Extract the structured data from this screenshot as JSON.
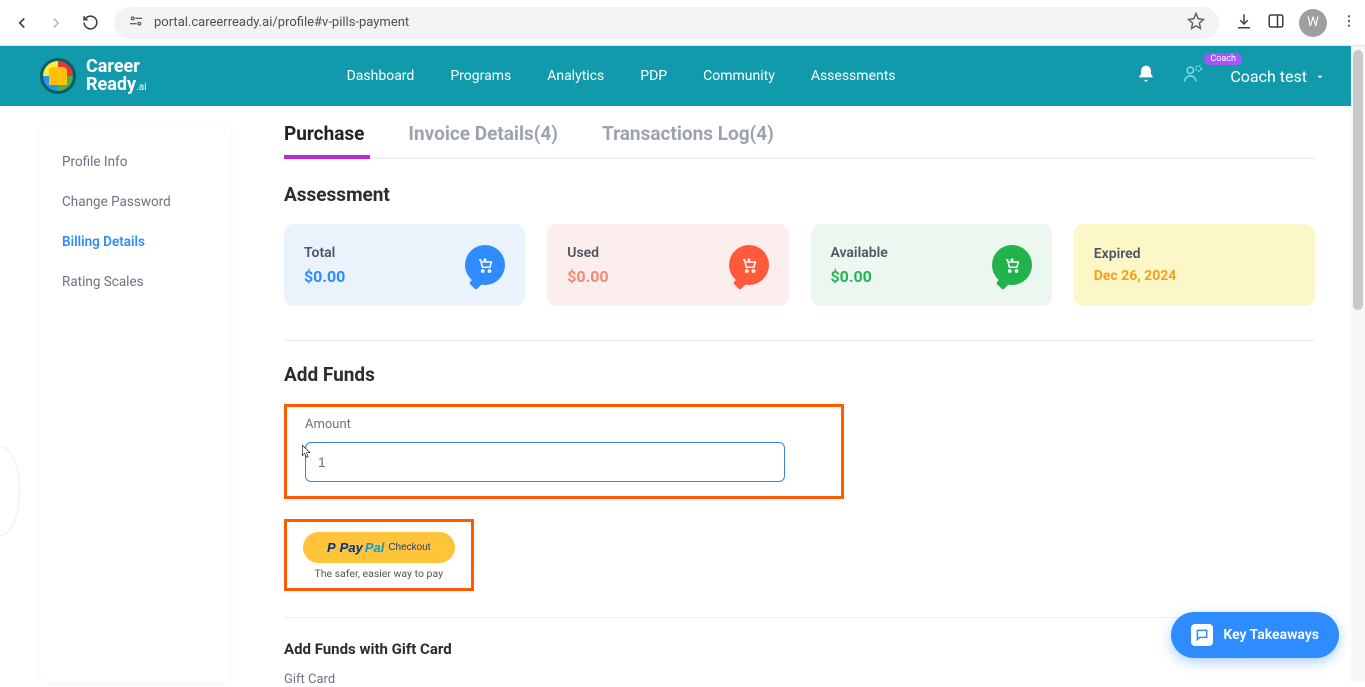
{
  "browser": {
    "url": "portal.careerready.ai/profile#v-pills-payment",
    "profile_initial": "W"
  },
  "appbar": {
    "logo_line1": "Career",
    "logo_line2": "Ready",
    "logo_suffix": ".ai",
    "nav": [
      "Dashboard",
      "Programs",
      "Analytics",
      "PDP",
      "Community",
      "Assessments"
    ],
    "badge": "Coach",
    "user": "Coach test"
  },
  "sidebar": {
    "items": [
      {
        "label": "Profile Info",
        "active": false
      },
      {
        "label": "Change Password",
        "active": false
      },
      {
        "label": "Billing Details",
        "active": true
      },
      {
        "label": "Rating Scales",
        "active": false
      }
    ]
  },
  "tabs": [
    {
      "label": "Purchase",
      "active": true
    },
    {
      "label": "Invoice Details(4)",
      "active": false
    },
    {
      "label": "Transactions Log(4)",
      "active": false
    }
  ],
  "assessment": {
    "title": "Assessment",
    "cards": {
      "total": {
        "label": "Total",
        "value": "$0.00"
      },
      "used": {
        "label": "Used",
        "value": "$0.00"
      },
      "available": {
        "label": "Available",
        "value": "$0.00"
      },
      "expired": {
        "label": "Expired",
        "value": "Dec 26, 2024"
      }
    }
  },
  "add_funds": {
    "title": "Add Funds",
    "amount_label": "Amount",
    "amount_value": "1",
    "paypal_checkout": "Checkout",
    "paypal_brand1": "Pay",
    "paypal_brand2": "Pal",
    "paypal_prefix": "P ",
    "paypal_sub": "The safer, easier way to pay"
  },
  "gift": {
    "title": "Add Funds with Gift Card",
    "label": "Gift Card"
  },
  "floating": {
    "takeaway": "Key Takeaways"
  }
}
